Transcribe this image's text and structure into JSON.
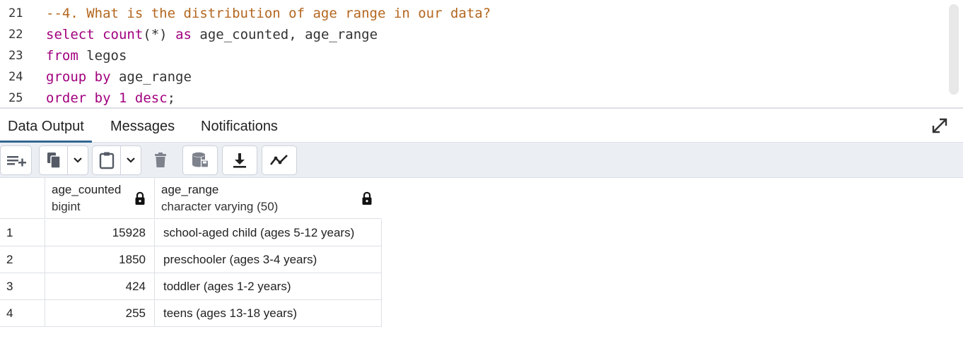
{
  "editor": {
    "lines": [
      {
        "num": "21",
        "tokens": [
          {
            "t": "--4. What is the distribution of age range in our data?",
            "k": "comment"
          }
        ]
      },
      {
        "num": "22",
        "tokens": [
          {
            "t": "select",
            "k": "kw"
          },
          {
            "t": " ",
            "k": "plain"
          },
          {
            "t": "count",
            "k": "kw"
          },
          {
            "t": "(*) ",
            "k": "plain"
          },
          {
            "t": "as",
            "k": "kw"
          },
          {
            "t": " age_counted, age_range",
            "k": "plain"
          }
        ]
      },
      {
        "num": "23",
        "tokens": [
          {
            "t": "from",
            "k": "kw"
          },
          {
            "t": " legos",
            "k": "plain"
          }
        ]
      },
      {
        "num": "24",
        "tokens": [
          {
            "t": "group by",
            "k": "kw"
          },
          {
            "t": " age_range",
            "k": "plain"
          }
        ]
      },
      {
        "num": "25",
        "tokens": [
          {
            "t": "order by",
            "k": "kw"
          },
          {
            "t": " ",
            "k": "plain"
          },
          {
            "t": "1",
            "k": "num"
          },
          {
            "t": " ",
            "k": "plain"
          },
          {
            "t": "desc",
            "k": "kw"
          },
          {
            "t": ";",
            "k": "plain"
          }
        ]
      }
    ]
  },
  "tabs": [
    {
      "label": "Data Output",
      "active": true
    },
    {
      "label": "Messages",
      "active": false
    },
    {
      "label": "Notifications",
      "active": false
    }
  ],
  "toolbar": {
    "icons": [
      "add-row-icon",
      "copy-icon",
      "chevron-down-icon",
      "paste-icon",
      "chevron-down-icon",
      "delete-icon",
      "save-data-icon",
      "download-icon",
      "graph-icon"
    ]
  },
  "grid": {
    "columns": [
      {
        "name": "age_counted",
        "type": "bigint"
      },
      {
        "name": "age_range",
        "type": "character varying (50)"
      }
    ],
    "rows": [
      {
        "num": "1",
        "age_counted": "15928",
        "age_range": "school-aged child (ages 5-12 years)"
      },
      {
        "num": "2",
        "age_counted": "1850",
        "age_range": "preschooler (ages 3-4 years)"
      },
      {
        "num": "3",
        "age_counted": "424",
        "age_range": "toddler (ages 1-2 years)"
      },
      {
        "num": "4",
        "age_counted": "255",
        "age_range": "teens (ages 13-18 years)"
      }
    ]
  },
  "colors": {
    "keyword": "#a1007e",
    "comment": "#b4661e",
    "accent": "#326690",
    "icon": "#555b66"
  }
}
